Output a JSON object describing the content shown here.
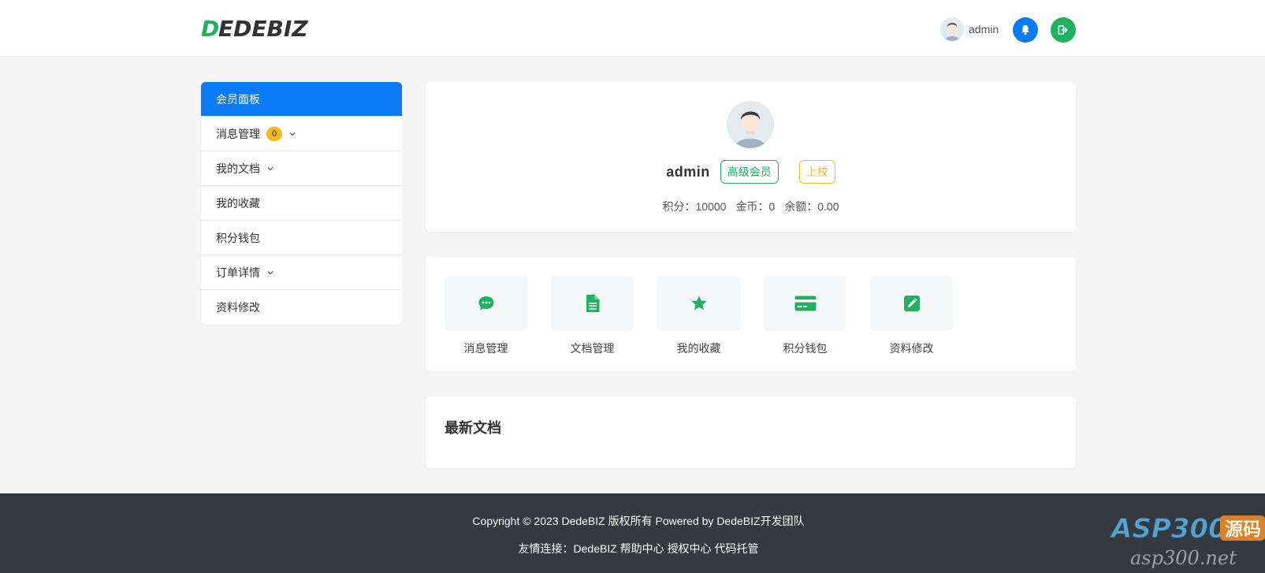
{
  "header": {
    "logo": "DEDEBIZ",
    "username": "admin"
  },
  "sidebar": {
    "items": [
      {
        "label": "会员面板"
      },
      {
        "label": "消息管理",
        "badge": "0"
      },
      {
        "label": "我的文档"
      },
      {
        "label": "我的收藏"
      },
      {
        "label": "积分钱包"
      },
      {
        "label": "订单详情"
      },
      {
        "label": "资料修改"
      }
    ]
  },
  "profile": {
    "name": "admin",
    "level_tag": "高级会员",
    "rank_tag": "上校",
    "points_label": "积分：10000",
    "coins_label": "金币：0",
    "balance_label": "余额：0.00"
  },
  "quick": {
    "items": [
      {
        "label": "消息管理",
        "icon": "chat-icon"
      },
      {
        "label": "文档管理",
        "icon": "document-icon"
      },
      {
        "label": "我的收藏",
        "icon": "star-icon"
      },
      {
        "label": "积分钱包",
        "icon": "credit-card-icon"
      },
      {
        "label": "资料修改",
        "icon": "edit-icon"
      }
    ]
  },
  "latest": {
    "title": "最新文档"
  },
  "footer": {
    "copyright": "Copyright © 2023 DedeBIZ 版权所有 Powered by DedeBIZ开发团队",
    "links_prefix": "友情连接：",
    "links": [
      "DedeBIZ",
      "帮助中心",
      "授权中心",
      "代码托管"
    ]
  },
  "watermark": {
    "text1": "ASP300",
    "text2": "源码",
    "text3": "asp300.net"
  },
  "colors": {
    "primary": "#0b7bf5",
    "green": "#1fb160",
    "yellow": "#f5bc16",
    "footer_bg": "#343a40"
  }
}
